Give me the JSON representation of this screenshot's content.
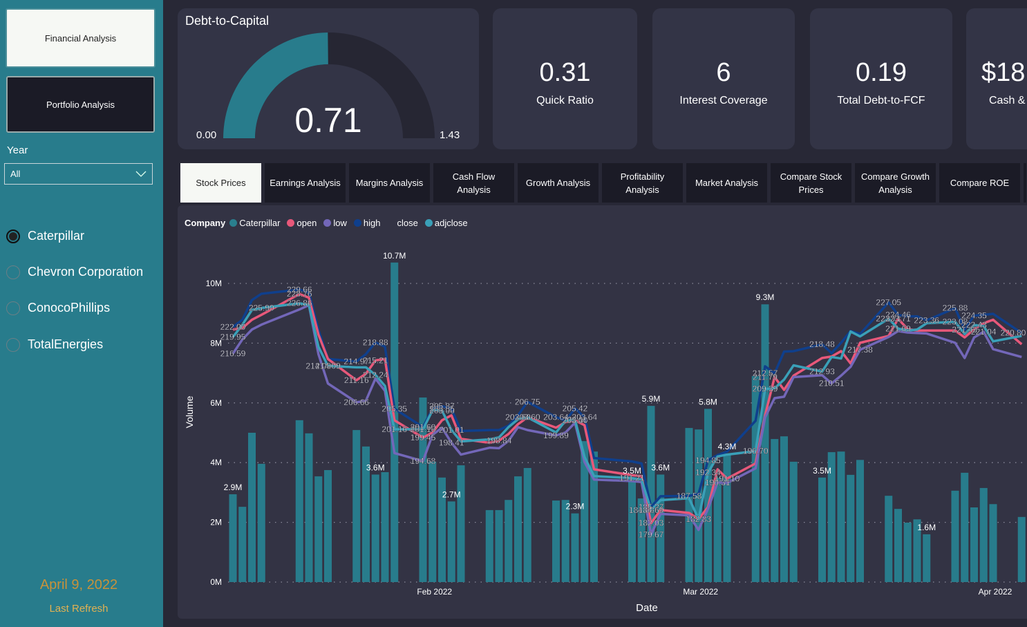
{
  "sidebar": {
    "nav": [
      "Financial Analysis",
      "Portfolio Analysis"
    ],
    "year_label": "Year",
    "year_value": "All",
    "companies": [
      "Caterpillar",
      "Chevron Corporation",
      "ConocoPhillips",
      "TotalEnergies"
    ],
    "selected_company": "Caterpillar",
    "refresh_date": "April 9, 2022",
    "refresh_label": "Last Refresh"
  },
  "gauge": {
    "title": "Debt-to-Capital",
    "value": 0.71,
    "value_text": "0.71",
    "min_text": "0.00",
    "max_text": "1.43",
    "min": 0,
    "max": 1.43,
    "fill_color": "#287c8c",
    "track_color": "#262633"
  },
  "kpis": [
    {
      "value": "0.31",
      "label": "Quick Ratio"
    },
    {
      "value": "6",
      "label": "Interest Coverage"
    },
    {
      "value": "0.19",
      "label": "Total Debt-to-FCF"
    },
    {
      "value": "$18",
      "label": "Cash &"
    }
  ],
  "tabs": [
    "Stock Prices",
    "Earnings Analysis",
    "Margins Analysis",
    "Cash Flow Analysis",
    "Growth Analysis",
    "Profitability Analysis",
    "Market Analysis",
    "Compare Stock Prices",
    "Compare Growth Analysis",
    "Compare ROE"
  ],
  "active_tab": "Stock Prices",
  "legend": {
    "title": "Company",
    "items": [
      {
        "label": "Caterpillar",
        "color": "#2a7f8e"
      },
      {
        "label": "open",
        "color": "#e8587a"
      },
      {
        "label": "low",
        "color": "#7367b9"
      },
      {
        "label": "high",
        "color": "#0f3f8c"
      },
      {
        "label": "close",
        "color": null
      },
      {
        "label": "adjclose",
        "color": "#3aa0b8"
      }
    ]
  },
  "chart_data": {
    "type": "bar+line",
    "xlabel": "Date",
    "ylabel": "Volume",
    "x_ticks": [
      "Feb 2022",
      "Mar 2022",
      "Apr 2022"
    ],
    "y_ticks": [
      "0M",
      "2M",
      "4M",
      "6M",
      "8M",
      "10M"
    ],
    "ylim_millions": [
      0,
      11
    ],
    "price_axis_range": [
      170,
      237
    ],
    "grid": "horizontal dotted",
    "dates": [
      "2022-01-11",
      "2022-01-12",
      "2022-01-13",
      "2022-01-14",
      "2022-01-18",
      "2022-01-19",
      "2022-01-20",
      "2022-01-21",
      "2022-01-24",
      "2022-01-25",
      "2022-01-26",
      "2022-01-27",
      "2022-01-28",
      "2022-01-31",
      "2022-02-01",
      "2022-02-02",
      "2022-02-03",
      "2022-02-04",
      "2022-02-07",
      "2022-02-08",
      "2022-02-09",
      "2022-02-10",
      "2022-02-11",
      "2022-02-14",
      "2022-02-15",
      "2022-02-16",
      "2022-02-17",
      "2022-02-18",
      "2022-02-22",
      "2022-02-23",
      "2022-02-24",
      "2022-02-25",
      "2022-02-28",
      "2022-03-01",
      "2022-03-02",
      "2022-03-03",
      "2022-03-04",
      "2022-03-07",
      "2022-03-08",
      "2022-03-09",
      "2022-03-10",
      "2022-03-11",
      "2022-03-14",
      "2022-03-15",
      "2022-03-16",
      "2022-03-17",
      "2022-03-18",
      "2022-03-21",
      "2022-03-22",
      "2022-03-23",
      "2022-03-24",
      "2022-03-25",
      "2022-03-28",
      "2022-03-29",
      "2022-03-30",
      "2022-03-31",
      "2022-04-01",
      "2022-04-04"
    ],
    "volume_millions": [
      2.94,
      2.52,
      5.0,
      3.96,
      5.42,
      4.98,
      3.54,
      3.75,
      5.09,
      4.54,
      3.6,
      3.68,
      10.7,
      6.18,
      4.03,
      3.5,
      2.7,
      3.91,
      2.41,
      2.41,
      2.75,
      3.54,
      3.82,
      2.73,
      2.75,
      2.3,
      4.72,
      4.37,
      3.5,
      2.8,
      5.9,
      3.6,
      5.16,
      5.11,
      5.8,
      3.5,
      4.3,
      6.9,
      9.3,
      4.79,
      4.88,
      4.03,
      3.5,
      4.35,
      4.37,
      3.59,
      4.09,
      2.89,
      2.45,
      1.99,
      2.1,
      1.6,
      3.06,
      3.66,
      2.5,
      3.15,
      2.61,
      2.18
    ],
    "volume_labels": [
      {
        "date": "2022-01-11",
        "text": "2.9M"
      },
      {
        "date": "2022-01-26",
        "text": "3.6M"
      },
      {
        "date": "2022-01-28",
        "text": "10.7M"
      },
      {
        "date": "2022-02-03",
        "text": "2.7M"
      },
      {
        "date": "2022-02-16",
        "text": "2.3M"
      },
      {
        "date": "2022-02-22",
        "text": "3.5M"
      },
      {
        "date": "2022-02-24",
        "text": "5.9M"
      },
      {
        "date": "2022-02-25",
        "text": "3.6M"
      },
      {
        "date": "2022-03-02",
        "text": "5.8M"
      },
      {
        "date": "2022-03-04",
        "text": "4.3M"
      },
      {
        "date": "2022-03-08",
        "text": "9.3M"
      },
      {
        "date": "2022-03-14",
        "text": "3.5M"
      },
      {
        "date": "2022-03-25",
        "text": "1.6M"
      }
    ],
    "series": [
      {
        "name": "high",
        "color": "#0f3f8c",
        "values": [
          222.0,
          223.5,
          227.5,
          228.8,
          229.66,
          229.0,
          221.5,
          215.5,
          214.97,
          216.5,
          218.88,
          218.0,
          205.35,
          201.6,
          205.35,
          205.87,
          205.35,
          200.8,
          201.0,
          201.0,
          201.9,
          204.0,
          206.75,
          203.64,
          202.9,
          205.42,
          203.64,
          195.3,
          194.6,
          194.2,
          185.27,
          187.5,
          187.58,
          188.0,
          194.85,
          195.9,
          196.6,
          202.9,
          214.0,
          212.57,
          217.0,
          217.1,
          218.48,
          216.7,
          218.8,
          221.2,
          220.6,
          227.05,
          224.46,
          224.2,
          224.2,
          223.36,
          225.88,
          221.43,
          224.35,
          224.5,
          224.7,
          220.8
        ]
      },
      {
        "name": "open",
        "color": "#e8587a",
        "values": [
          221.5,
          221.8,
          223.5,
          224.5,
          228.76,
          228.0,
          220.5,
          215.5,
          211.16,
          212.5,
          215.21,
          215.5,
          203.0,
          199.45,
          200.5,
          203.0,
          204.0,
          199.2,
          198.4,
          198.84,
          200.2,
          202.2,
          203.6,
          201.5,
          202.6,
          203.0,
          202.0,
          193.0,
          191.8,
          191.6,
          182.03,
          184.7,
          184.1,
          182.83,
          185.3,
          193.0,
          191.1,
          194.2,
          204.0,
          211.79,
          209.2,
          212.1,
          215.7,
          216.0,
          217.1,
          214.6,
          218.8,
          220.2,
          223.71,
          221.6,
          221.3,
          221.3,
          221.3,
          219.9,
          221.6,
          222.8,
          223.5,
          218.5
        ]
      },
      {
        "name": "low",
        "color": "#7367b9",
        "values": [
          216.59,
          219.5,
          221.5,
          222.5,
          225.6,
          226.5,
          216.5,
          210.5,
          206.66,
          207.0,
          211.5,
          209.0,
          196.3,
          194.68,
          200.0,
          201.5,
          198.41,
          196.0,
          197.4,
          197.3,
          198.8,
          201.6,
          201.0,
          199.89,
          200.5,
          202.5,
          194.5,
          190.9,
          190.6,
          190.4,
          179.67,
          183.9,
          183.6,
          180.64,
          185.0,
          190.31,
          190.2,
          193.2,
          203.6,
          207.5,
          207.8,
          211.8,
          212.2,
          210.51,
          212.1,
          213.9,
          217.38,
          220.0,
          221.2,
          220.9,
          220.8,
          220.7,
          218.8,
          215.7,
          219.9,
          221.04,
          217.5,
          215.9
        ]
      },
      {
        "name": "adjclose",
        "color": "#3aa0b8",
        "values": [
          219.95,
          222.5,
          225.5,
          225.9,
          226.86,
          226.5,
          218.0,
          214.09,
          213.8,
          213.8,
          212.24,
          210.0,
          201.16,
          201.16,
          205.0,
          205.0,
          201.01,
          198.7,
          199.1,
          199.5,
          201.6,
          203.2,
          203.6,
          200.5,
          202.9,
          203.11,
          195.5,
          191.6,
          191.21,
          190.9,
          184.69,
          186.7,
          187.1,
          182.83,
          192.34,
          195.6,
          196.0,
          196.7,
          209.39,
          209.5,
          211.3,
          214.2,
          212.93,
          215.9,
          215.6,
          221.1,
          220.1,
          223.71,
          221.69,
          221.3,
          221.5,
          222.8,
          223.08,
          220.6,
          222.43,
          222.2,
          219.1,
          220.2
        ]
      }
    ],
    "bar_color": "#287c8c",
    "price_labels": [
      {
        "date": "2022-01-11",
        "value": "222.00"
      },
      {
        "date": "2022-01-11",
        "value": "219.95"
      },
      {
        "date": "2022-01-11",
        "value": "216.59"
      },
      {
        "date": "2022-01-14",
        "value": "225.90"
      },
      {
        "date": "2022-01-18",
        "value": "229.66"
      },
      {
        "date": "2022-01-18",
        "value": "226.86"
      },
      {
        "date": "2022-01-18",
        "value": "228.76"
      },
      {
        "date": "2022-01-20",
        "value": "214.09"
      },
      {
        "date": "2022-01-21",
        "value": "214.09"
      },
      {
        "date": "2022-01-24",
        "value": "214.97"
      },
      {
        "date": "2022-01-24",
        "value": "211.16"
      },
      {
        "date": "2022-01-24",
        "value": "206.66"
      },
      {
        "date": "2022-01-26",
        "value": "218.88"
      },
      {
        "date": "2022-01-26",
        "value": "215.21"
      },
      {
        "date": "2022-01-26",
        "value": "212.24"
      },
      {
        "date": "2022-01-28",
        "value": "205.35"
      },
      {
        "date": "2022-01-28",
        "value": "201.16"
      },
      {
        "date": "2022-01-31",
        "value": "201.16"
      },
      {
        "date": "2022-01-31",
        "value": "201.60"
      },
      {
        "date": "2022-01-31",
        "value": "199.45"
      },
      {
        "date": "2022-01-31",
        "value": "194.68"
      },
      {
        "date": "2022-02-02",
        "value": "205.00"
      },
      {
        "date": "2022-02-02",
        "value": "205.35"
      },
      {
        "date": "2022-02-02",
        "value": "205.87"
      },
      {
        "date": "2022-02-03",
        "value": "198.41"
      },
      {
        "date": "2022-02-03",
        "value": "201.01"
      },
      {
        "date": "2022-02-08",
        "value": "198.84"
      },
      {
        "date": "2022-02-11",
        "value": "206.75"
      },
      {
        "date": "2022-02-10",
        "value": "203.60"
      },
      {
        "date": "2022-02-11",
        "value": "203.60"
      },
      {
        "date": "2022-02-14",
        "value": "203.64"
      },
      {
        "date": "2022-02-14",
        "value": "199.89"
      },
      {
        "date": "2022-02-16",
        "value": "205.42"
      },
      {
        "date": "2022-02-16",
        "value": "203.11"
      },
      {
        "date": "2022-02-16",
        "value": "203.00"
      },
      {
        "date": "2022-02-17",
        "value": "203.64"
      },
      {
        "date": "2022-02-22",
        "value": "191.21"
      },
      {
        "date": "2022-02-23",
        "value": "184.69"
      },
      {
        "date": "2022-02-24",
        "value": "185.27"
      },
      {
        "date": "2022-02-24",
        "value": "182.03"
      },
      {
        "date": "2022-02-24",
        "value": "179.67"
      },
      {
        "date": "2022-02-24",
        "value": "184.69"
      },
      {
        "date": "2022-02-28",
        "value": "187.58"
      },
      {
        "date": "2022-03-01",
        "value": "182.83"
      },
      {
        "date": "2022-03-01",
        "value": "182.83"
      },
      {
        "date": "2022-03-02",
        "value": "194.85"
      },
      {
        "date": "2022-03-02",
        "value": "192.34"
      },
      {
        "date": "2022-03-03",
        "value": "190.31"
      },
      {
        "date": "2022-03-04",
        "value": "191.10"
      },
      {
        "date": "2022-03-07",
        "value": "196.70"
      },
      {
        "date": "2022-03-08",
        "value": "212.57"
      },
      {
        "date": "2022-03-08",
        "value": "211.79"
      },
      {
        "date": "2022-03-08",
        "value": "209.39"
      },
      {
        "date": "2022-03-14",
        "value": "218.48"
      },
      {
        "date": "2022-03-14",
        "value": "212.93"
      },
      {
        "date": "2022-03-15",
        "value": "210.51"
      },
      {
        "date": "2022-03-18",
        "value": "217.38"
      },
      {
        "date": "2022-03-21",
        "value": "227.05"
      },
      {
        "date": "2022-03-21",
        "value": "223.71"
      },
      {
        "date": "2022-03-22",
        "value": "224.46"
      },
      {
        "date": "2022-03-22",
        "value": "223.71"
      },
      {
        "date": "2022-03-22",
        "value": "221.69"
      },
      {
        "date": "2022-03-25",
        "value": "223.36"
      },
      {
        "date": "2022-03-28",
        "value": "225.88"
      },
      {
        "date": "2022-03-28",
        "value": "223.08"
      },
      {
        "date": "2022-03-29",
        "value": "221.43"
      },
      {
        "date": "2022-03-30",
        "value": "224.35"
      },
      {
        "date": "2022-03-30",
        "value": "222.43"
      },
      {
        "date": "2022-03-31",
        "value": "221.04"
      },
      {
        "date": "2022-04-04",
        "value": "220.80"
      }
    ]
  }
}
